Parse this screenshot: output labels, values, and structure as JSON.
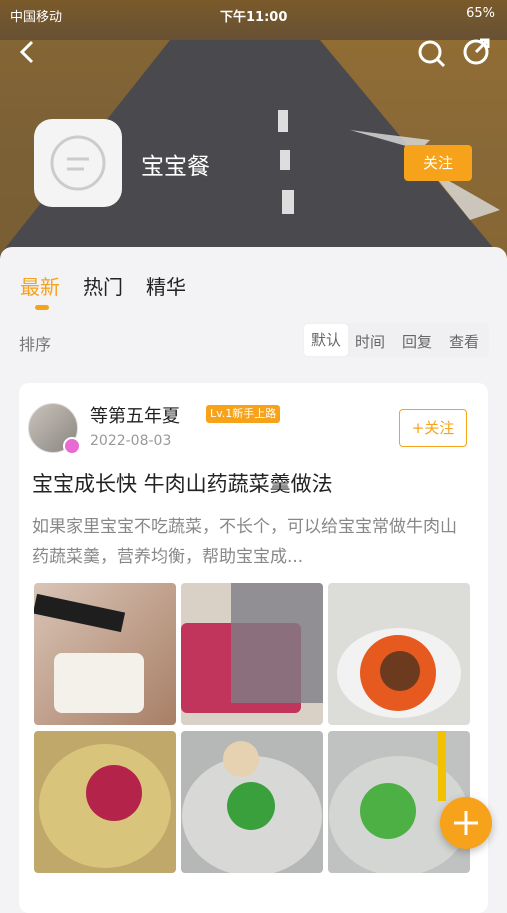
{
  "status_bar": {
    "carrier": "中国移动",
    "time": "下午11:00",
    "battery": "65%"
  },
  "header": {
    "group_name": "宝宝餐",
    "follow_label": "关注"
  },
  "tabs": [
    {
      "label": "最新"
    },
    {
      "label": "热门"
    },
    {
      "label": "精华"
    }
  ],
  "sort": {
    "label": "排序",
    "options": [
      "默认",
      "时间",
      "回复",
      "查看"
    ]
  },
  "post": {
    "username": "等第五年夏",
    "level": "Lv.1新手上路",
    "date": "2022-08-03",
    "follow_label": "+关注",
    "title": "宝宝成长快 牛肉山药蔬菜羹做法",
    "excerpt": "如果家里宝宝不吃蔬菜，不长个，可以给宝宝常做牛肉山药蔬菜羹，营养均衡，帮助宝宝成..."
  },
  "icons": {
    "back": "back-arrow-icon",
    "search": "search-icon",
    "share": "share-icon",
    "add": "plus-icon"
  }
}
